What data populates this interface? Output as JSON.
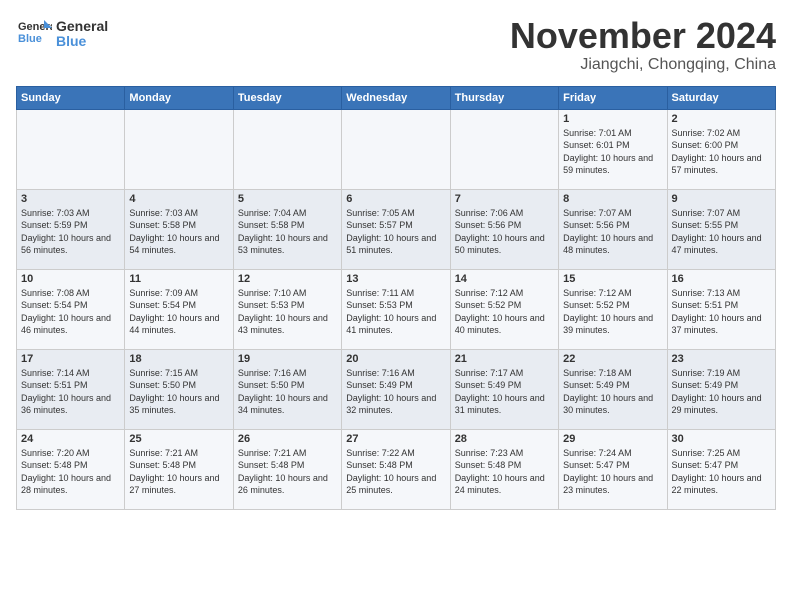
{
  "logo": {
    "line1": "General",
    "line2": "Blue"
  },
  "title": "November 2024",
  "subtitle": "Jiangchi, Chongqing, China",
  "weekdays": [
    "Sunday",
    "Monday",
    "Tuesday",
    "Wednesday",
    "Thursday",
    "Friday",
    "Saturday"
  ],
  "weeks": [
    [
      {
        "day": "",
        "info": ""
      },
      {
        "day": "",
        "info": ""
      },
      {
        "day": "",
        "info": ""
      },
      {
        "day": "",
        "info": ""
      },
      {
        "day": "",
        "info": ""
      },
      {
        "day": "1",
        "info": "Sunrise: 7:01 AM\nSunset: 6:01 PM\nDaylight: 10 hours and 59 minutes."
      },
      {
        "day": "2",
        "info": "Sunrise: 7:02 AM\nSunset: 6:00 PM\nDaylight: 10 hours and 57 minutes."
      }
    ],
    [
      {
        "day": "3",
        "info": "Sunrise: 7:03 AM\nSunset: 5:59 PM\nDaylight: 10 hours and 56 minutes."
      },
      {
        "day": "4",
        "info": "Sunrise: 7:03 AM\nSunset: 5:58 PM\nDaylight: 10 hours and 54 minutes."
      },
      {
        "day": "5",
        "info": "Sunrise: 7:04 AM\nSunset: 5:58 PM\nDaylight: 10 hours and 53 minutes."
      },
      {
        "day": "6",
        "info": "Sunrise: 7:05 AM\nSunset: 5:57 PM\nDaylight: 10 hours and 51 minutes."
      },
      {
        "day": "7",
        "info": "Sunrise: 7:06 AM\nSunset: 5:56 PM\nDaylight: 10 hours and 50 minutes."
      },
      {
        "day": "8",
        "info": "Sunrise: 7:07 AM\nSunset: 5:56 PM\nDaylight: 10 hours and 48 minutes."
      },
      {
        "day": "9",
        "info": "Sunrise: 7:07 AM\nSunset: 5:55 PM\nDaylight: 10 hours and 47 minutes."
      }
    ],
    [
      {
        "day": "10",
        "info": "Sunrise: 7:08 AM\nSunset: 5:54 PM\nDaylight: 10 hours and 46 minutes."
      },
      {
        "day": "11",
        "info": "Sunrise: 7:09 AM\nSunset: 5:54 PM\nDaylight: 10 hours and 44 minutes."
      },
      {
        "day": "12",
        "info": "Sunrise: 7:10 AM\nSunset: 5:53 PM\nDaylight: 10 hours and 43 minutes."
      },
      {
        "day": "13",
        "info": "Sunrise: 7:11 AM\nSunset: 5:53 PM\nDaylight: 10 hours and 41 minutes."
      },
      {
        "day": "14",
        "info": "Sunrise: 7:12 AM\nSunset: 5:52 PM\nDaylight: 10 hours and 40 minutes."
      },
      {
        "day": "15",
        "info": "Sunrise: 7:12 AM\nSunset: 5:52 PM\nDaylight: 10 hours and 39 minutes."
      },
      {
        "day": "16",
        "info": "Sunrise: 7:13 AM\nSunset: 5:51 PM\nDaylight: 10 hours and 37 minutes."
      }
    ],
    [
      {
        "day": "17",
        "info": "Sunrise: 7:14 AM\nSunset: 5:51 PM\nDaylight: 10 hours and 36 minutes."
      },
      {
        "day": "18",
        "info": "Sunrise: 7:15 AM\nSunset: 5:50 PM\nDaylight: 10 hours and 35 minutes."
      },
      {
        "day": "19",
        "info": "Sunrise: 7:16 AM\nSunset: 5:50 PM\nDaylight: 10 hours and 34 minutes."
      },
      {
        "day": "20",
        "info": "Sunrise: 7:16 AM\nSunset: 5:49 PM\nDaylight: 10 hours and 32 minutes."
      },
      {
        "day": "21",
        "info": "Sunrise: 7:17 AM\nSunset: 5:49 PM\nDaylight: 10 hours and 31 minutes."
      },
      {
        "day": "22",
        "info": "Sunrise: 7:18 AM\nSunset: 5:49 PM\nDaylight: 10 hours and 30 minutes."
      },
      {
        "day": "23",
        "info": "Sunrise: 7:19 AM\nSunset: 5:49 PM\nDaylight: 10 hours and 29 minutes."
      }
    ],
    [
      {
        "day": "24",
        "info": "Sunrise: 7:20 AM\nSunset: 5:48 PM\nDaylight: 10 hours and 28 minutes."
      },
      {
        "day": "25",
        "info": "Sunrise: 7:21 AM\nSunset: 5:48 PM\nDaylight: 10 hours and 27 minutes."
      },
      {
        "day": "26",
        "info": "Sunrise: 7:21 AM\nSunset: 5:48 PM\nDaylight: 10 hours and 26 minutes."
      },
      {
        "day": "27",
        "info": "Sunrise: 7:22 AM\nSunset: 5:48 PM\nDaylight: 10 hours and 25 minutes."
      },
      {
        "day": "28",
        "info": "Sunrise: 7:23 AM\nSunset: 5:48 PM\nDaylight: 10 hours and 24 minutes."
      },
      {
        "day": "29",
        "info": "Sunrise: 7:24 AM\nSunset: 5:47 PM\nDaylight: 10 hours and 23 minutes."
      },
      {
        "day": "30",
        "info": "Sunrise: 7:25 AM\nSunset: 5:47 PM\nDaylight: 10 hours and 22 minutes."
      }
    ]
  ]
}
